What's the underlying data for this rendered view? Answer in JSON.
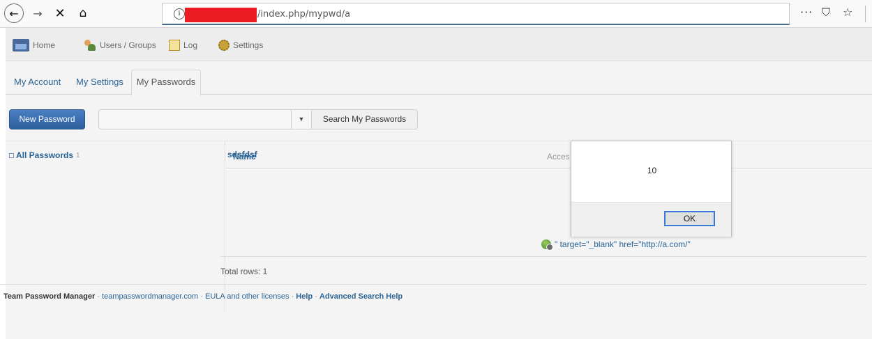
{
  "browser": {
    "url_suffix": "/index.php/mypwd/a",
    "info_glyph": "i",
    "more_glyph": "···",
    "icons": [
      "back-icon",
      "forward-icon",
      "stop-icon",
      "home-icon",
      "info-icon",
      "more-icon",
      "pocket-icon",
      "star-icon"
    ]
  },
  "menu": {
    "items": [
      {
        "label": "Home",
        "icon": "home-icon"
      },
      {
        "label": "Users / Groups",
        "icon": "users-icon"
      },
      {
        "label": "Log",
        "icon": "log-icon"
      },
      {
        "label": "Settings",
        "icon": "gear-icon"
      }
    ]
  },
  "tabs": {
    "items": [
      {
        "label": "My Account"
      },
      {
        "label": "My Settings"
      },
      {
        "label": "My Passwords",
        "active": true
      }
    ]
  },
  "toolbar": {
    "new_password_label": "New Password",
    "search_value": "",
    "search_button_label": "Search My Passwords"
  },
  "tree": {
    "root_label": "All Passwords",
    "root_count": "1"
  },
  "table": {
    "columns": [
      "Name",
      "Acces"
    ],
    "rows": [
      {
        "name": "sdsfdsf",
        "access": "\" target=\"_blank\" href=\"http://a.com/\""
      }
    ],
    "total_rows": "Total rows: 1"
  },
  "footer": {
    "app_name": "Team Password Manager",
    "sep": "·",
    "site_link": "teampasswordmanager.com",
    "eula_link": "EULA and other licenses",
    "help_link": "Help",
    "adv_help_link": "Advanced Search Help"
  },
  "alert": {
    "message": "10",
    "ok_label": "OK"
  },
  "colors": {
    "accent": "#2a6496",
    "primary_button": "#2e5f9e",
    "redaction": "#ed1c24",
    "focus_ring": "#3b78d8"
  }
}
